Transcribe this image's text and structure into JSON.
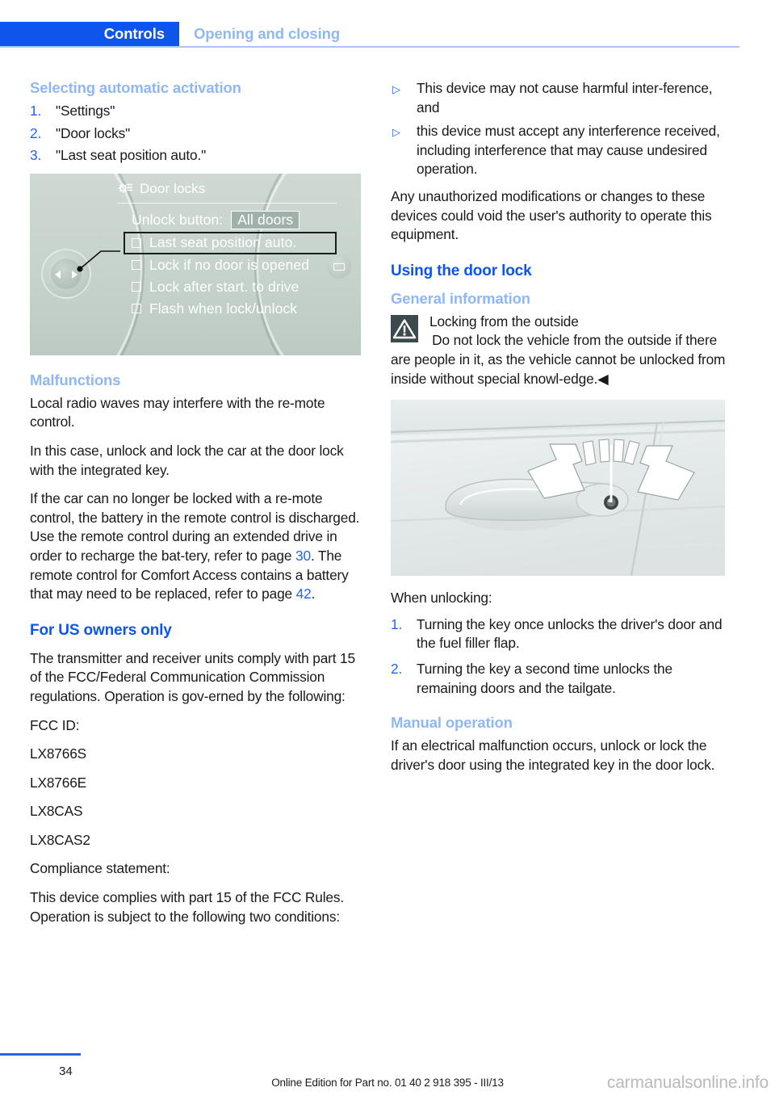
{
  "header": {
    "chapter": "Controls",
    "section": "Opening and closing",
    "accent_blue": "#0d55ed",
    "light_blue": "#8fb8f3"
  },
  "left_column": {
    "heading_selecting": "Selecting automatic activation",
    "steps": [
      {
        "num": "1.",
        "text": "\"Settings\""
      },
      {
        "num": "2.",
        "text": "\"Door locks\""
      },
      {
        "num": "3.",
        "text": "\"Last seat position auto.\""
      }
    ],
    "idrive_screen": {
      "icon": "settings-gear-icon",
      "title": "Door locks",
      "unlock_label": "Unlock button:",
      "unlock_value": "All doors",
      "options": [
        {
          "label": "Last seat position auto.",
          "selected": true
        },
        {
          "label": "Lock if no door is opened",
          "selected": false
        },
        {
          "label": "Lock after start. to drive",
          "selected": false
        },
        {
          "label": "Flash when lock/unlock",
          "selected": false
        }
      ]
    },
    "heading_malfunctions": "Malfunctions",
    "p_malf_1": "Local radio waves may interfere with the re-mote control.",
    "p_malf_2": "In this case, unlock and lock the car at the door lock with the integrated key.",
    "p_malf_3a": "If the car can no longer be locked with a re-mote control, the battery in the remote control is discharged. Use the remote control during an extended drive in order to recharge the bat-tery, refer to page ",
    "p_malf_ref1": "30",
    "p_malf_3b": ". The remote control for Comfort Access contains a battery that may need to be replaced, refer to page ",
    "p_malf_ref2": "42",
    "p_malf_3c": ".",
    "heading_us_owners": "For US owners only",
    "p_us_1": "The transmitter and receiver units comply with part 15 of the FCC/Federal Communication Commission regulations. Operation is gov-erned by the following:",
    "p_fcc_id_label": "FCC ID:",
    "fcc_ids": [
      "LX8766S",
      "LX8766E",
      "LX8CAS",
      "LX8CAS2"
    ],
    "p_compliance_label": "Compliance statement:",
    "p_compliance_text": "This device complies with part 15 of the FCC Rules. Operation is subject to the following two conditions:"
  },
  "right_column": {
    "conditions": [
      "This device may not cause harmful inter-ference, and",
      "this device must accept any interference received, including interference that may cause undesired operation."
    ],
    "p_unauthorized": "Any unauthorized modifications or changes to these devices could void the user's authority to operate this equipment.",
    "heading_using_door_lock": "Using the door lock",
    "heading_general_info": "General information",
    "warning": {
      "icon": "warning-triangle-icon",
      "title": "Locking from the outside",
      "text": "Do not lock the vehicle from the outside if there are people in it, as the vehicle cannot be unlocked from inside without special knowl-edge.",
      "end_marker": "◀"
    },
    "door_photo": {
      "alt": "car-door-handle-with-lock-cylinder-and-rotation-arrows"
    },
    "p_when_unlocking": "When unlocking:",
    "unlock_steps": [
      {
        "num": "1.",
        "text": "Turning the key once unlocks the driver's door and the fuel filler flap."
      },
      {
        "num": "2.",
        "text": "Turning the key a second time unlocks the remaining doors and the tailgate."
      }
    ],
    "heading_manual_operation": "Manual operation",
    "p_manual": "If an electrical malfunction occurs, unlock or lock the driver's door using the integrated key in the door lock."
  },
  "footer": {
    "page_number": "34",
    "edition": "Online Edition for Part no. 01 40 2 918 395 - III/13",
    "watermark": "carmanualsonline.info"
  }
}
